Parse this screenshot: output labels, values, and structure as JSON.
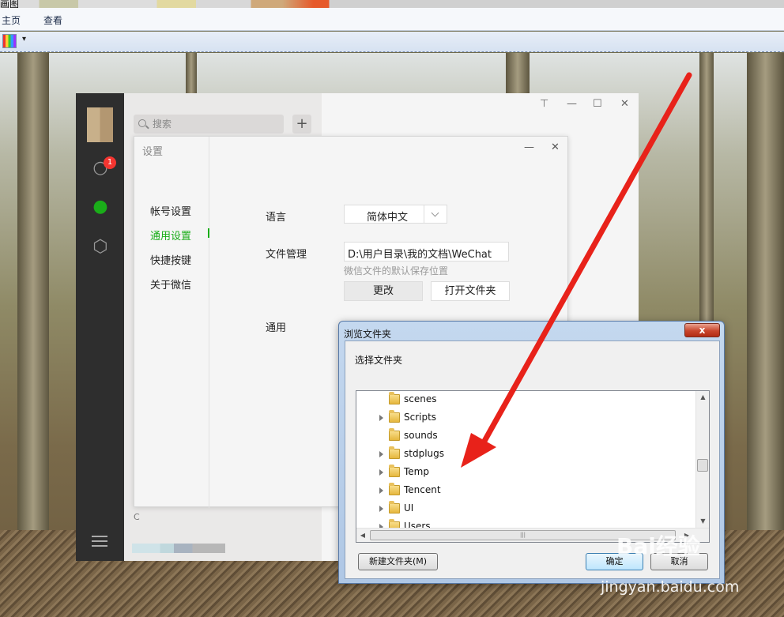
{
  "window": {
    "title": "画图"
  },
  "menu": {
    "items": [
      "主页",
      "查看"
    ]
  },
  "toolbar": {
    "dropdown_glyph": "▾"
  },
  "wechat": {
    "search_placeholder": "搜索",
    "add_label": "+",
    "unread_count": "1",
    "list_footer_letter": "C",
    "window_controls": [
      "⊤",
      "—",
      "☐",
      "✕"
    ]
  },
  "settings": {
    "title": "设置",
    "controls": [
      "—",
      "✕"
    ],
    "nav": [
      "帐号设置",
      "通用设置",
      "快捷按键",
      "关于微信"
    ],
    "active_index": 1,
    "language_label": "语言",
    "language_value": "简体中文",
    "file_label": "文件管理",
    "file_path": "D:\\用户目录\\我的文档\\WeChat",
    "file_hint": "微信文件的默认保存位置",
    "change_button": "更改",
    "open_folder_button": "打开文件夹",
    "general_label": "通用"
  },
  "browse_dialog": {
    "title": "浏览文件夹",
    "close": "x",
    "prompt": "选择文件夹",
    "folders": [
      {
        "name": "scenes",
        "expandable": false
      },
      {
        "name": "Scripts",
        "expandable": true
      },
      {
        "name": "sounds",
        "expandable": false
      },
      {
        "name": "stdplugs",
        "expandable": true
      },
      {
        "name": "Temp",
        "expandable": true
      },
      {
        "name": "Tencent",
        "expandable": true
      },
      {
        "name": "UI",
        "expandable": true
      },
      {
        "name": "Users",
        "expandable": true
      }
    ],
    "scroll_up": "▲",
    "scroll_down": "▼",
    "scroll_left": "◀",
    "scroll_right": "▶",
    "hscroll_grip": "|||",
    "new_folder_button": "新建文件夹(M)",
    "ok_button": "确定",
    "cancel_button": "取消"
  },
  "watermark": {
    "logo": "Bai经验",
    "url": "jingyan.baidu.com"
  },
  "colors": {
    "wechat_green": "#1aad19",
    "arrow_red": "#e8221a",
    "badge_red": "#f43530"
  }
}
